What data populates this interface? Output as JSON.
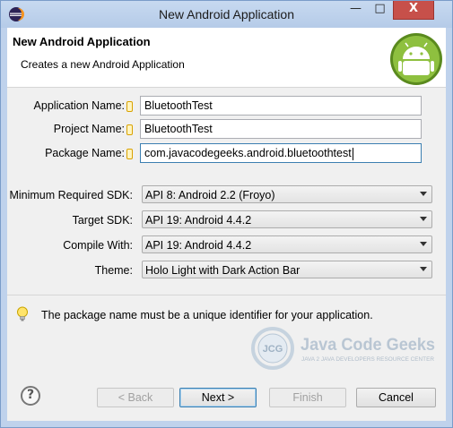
{
  "window": {
    "title": "New Android Application",
    "controls": {
      "minimize": "—",
      "maximize": "□",
      "close": "X"
    }
  },
  "header": {
    "title": "New Android Application",
    "description": "Creates a new Android Application",
    "logo_icon": "android-logo-icon"
  },
  "fields": {
    "application_name": {
      "label": "Application Name:",
      "value": "BluetoothTest"
    },
    "project_name": {
      "label": "Project Name:",
      "value": "BluetoothTest"
    },
    "package_name": {
      "label": "Package Name:",
      "value": "com.javacodegeeks.android.bluetoothtest"
    }
  },
  "selects": {
    "min_sdk": {
      "label": "Minimum Required SDK:",
      "value": "API 8: Android 2.2 (Froyo)"
    },
    "target_sdk": {
      "label": "Target SDK:",
      "value": "API 19: Android 4.4.2"
    },
    "compile_with": {
      "label": "Compile With:",
      "value": "API 19: Android 4.4.2"
    },
    "theme": {
      "label": "Theme:",
      "value": "Holo Light with Dark Action Bar"
    }
  },
  "hint": {
    "icon": "lightbulb-icon",
    "text": "The package name must be a unique identifier for your application."
  },
  "watermark": {
    "logo_text": "JCG",
    "brand": "Java Code Geeks",
    "tagline": "JAVA 2 JAVA DEVELOPERS RESOURCE CENTER"
  },
  "buttons": {
    "help": "?",
    "back": "< Back",
    "next": "Next >",
    "finish": "Finish",
    "cancel": "Cancel"
  },
  "colors": {
    "title_bar": "#bfd2ec",
    "close_button": "#c7504a",
    "dialog_bg": "#f0f0f0",
    "android_green": "#8ec03f"
  }
}
